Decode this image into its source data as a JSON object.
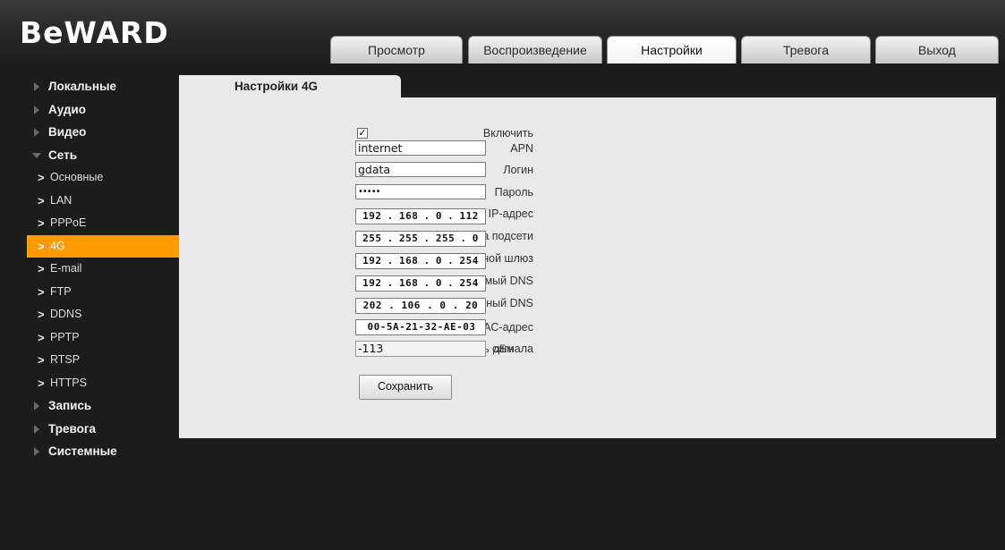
{
  "logo": "BeWARD",
  "nav": {
    "tabs": [
      "Просмотр",
      "Воспроизведение",
      "Настройки",
      "Тревога",
      "Выход"
    ],
    "active": "Настройки"
  },
  "sidebar": {
    "local": "Локальные",
    "audio": "Аудио",
    "video": "Видео",
    "network": "Сеть",
    "network_items": [
      "Основные",
      "LAN",
      "PPPoE",
      "4G",
      "E-mail",
      "FTP",
      "DDNS",
      "PPTP",
      "RTSP",
      "HTTPS"
    ],
    "network_active": "4G",
    "record": "Запись",
    "alarm": "Тревога",
    "system": "Системные"
  },
  "page": {
    "tab_title": "Настройки 4G",
    "enable_label": "Включить",
    "enable_checked": true,
    "apn_label": "APN",
    "apn_value": "internet",
    "login_label": "Логин",
    "login_value": "gdata",
    "password_label": "Пароль",
    "password_value": "•••••",
    "ip_label": "IP-адрес",
    "ip": [
      "192",
      "168",
      "0",
      "112"
    ],
    "mask_label": "Маска подсети",
    "mask": [
      "255",
      "255",
      "255",
      "0"
    ],
    "gateway_label": "Основной шлюз",
    "gateway": [
      "192",
      "168",
      "0",
      "254"
    ],
    "dns1_label": "Предпочитаемый DNS",
    "dns1": [
      "192",
      "168",
      "0",
      "254"
    ],
    "dns2_label": "Альтернативный DNS",
    "dns2": [
      "202",
      "106",
      "0",
      "20"
    ],
    "mac_label": "MAC-адрес",
    "mac_value": "00-5A-21-32-AE-03",
    "signal_label": "Уровень сигнала",
    "signal_value": "-113",
    "signal_unit": "дБм",
    "save_label": "Сохранить"
  },
  "colors": {
    "accent": "#ff9a00",
    "background": "#1c1c1c",
    "panel": "#e9e9e9"
  }
}
